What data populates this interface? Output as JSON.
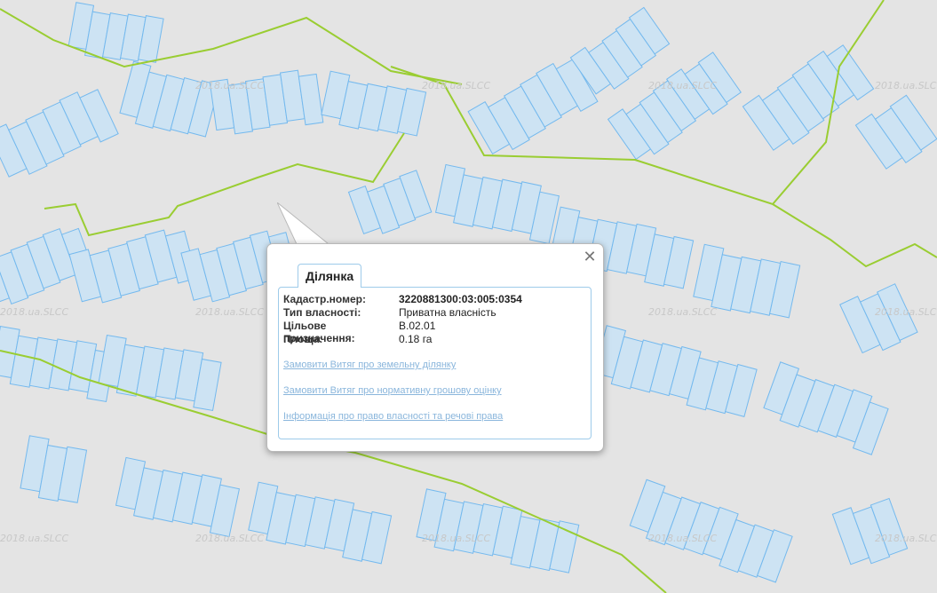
{
  "map": {
    "watermark": "2018.ua.SLCC",
    "colors": {
      "background": "#e4e4e4",
      "parcel_fill": "#cde3f3",
      "parcel_stroke": "#74b9ee",
      "boundary": "#9acd32"
    }
  },
  "popup": {
    "tab_label": "Ділянка",
    "close_label": "✕",
    "fields": [
      {
        "key": "Кадастр.номер:",
        "value": "3220881300:03:005:0354",
        "bold": true
      },
      {
        "key": "Тип власності:",
        "value": "Приватна власність"
      },
      {
        "key": "Цільове призначення:",
        "value": "B.02.01"
      },
      {
        "key": "Площа:",
        "value": "0.18 га"
      }
    ],
    "links": [
      "Замовити Витяг про земельну ділянку",
      "Замовити Витяг про нормативну грошову оцінку",
      "Інформація про право власності та речові права"
    ]
  }
}
